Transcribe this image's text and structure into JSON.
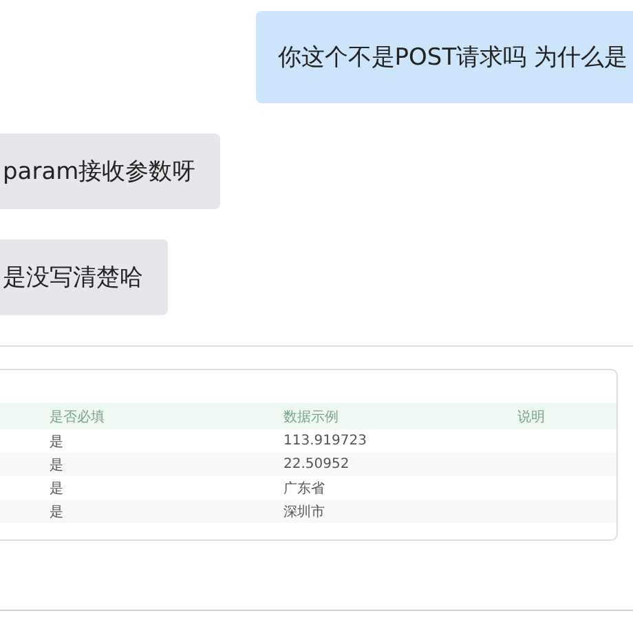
{
  "messages": [
    {
      "text": "你这个不是POST请求吗 为什么是",
      "kind": "sent"
    },
    {
      "text": "param接收参数呀",
      "kind": "received"
    },
    {
      "text": "是没写清楚哈",
      "kind": "received"
    }
  ],
  "table": {
    "columns": [
      "是否必填",
      "数据示例",
      "说明"
    ],
    "rows": [
      [
        "是",
        "113.919723"
      ],
      [
        "是",
        "22.50952"
      ],
      [
        "是",
        "广东省"
      ],
      [
        "是",
        "深圳市"
      ]
    ]
  }
}
